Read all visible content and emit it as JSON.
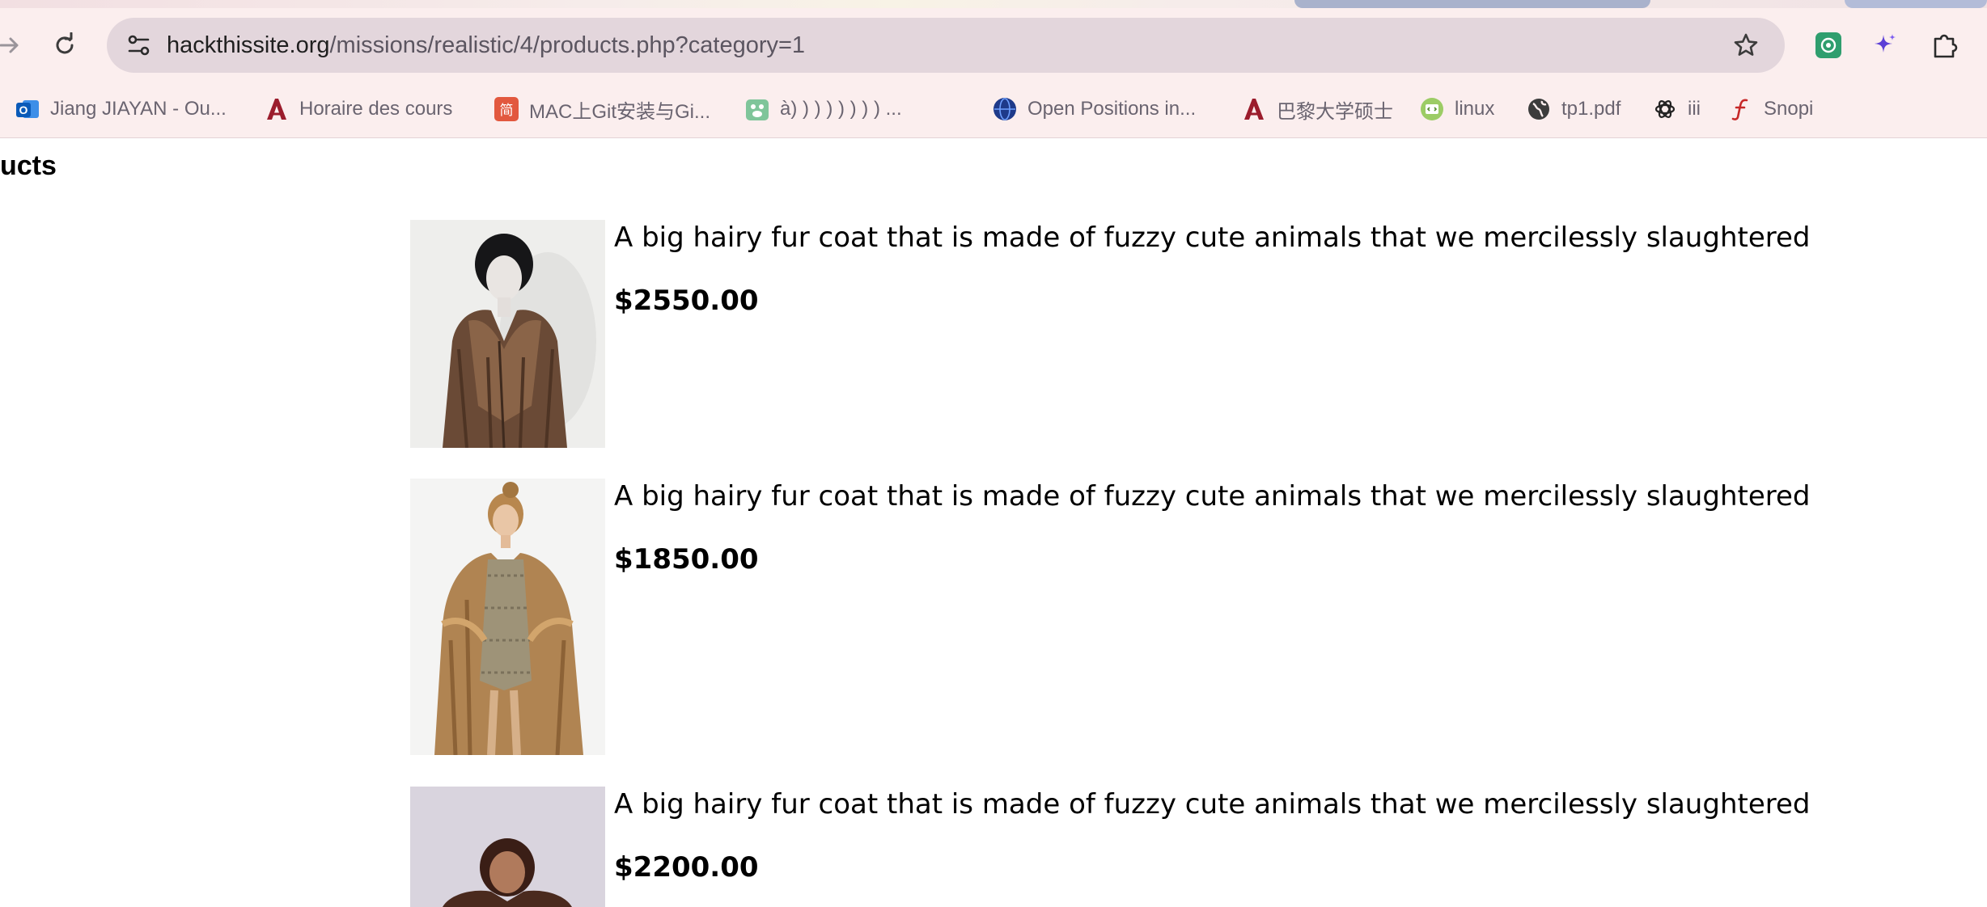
{
  "browser": {
    "url_host": "hackthissite.org",
    "url_path": "/missions/realistic/4/products.php?category=1",
    "bookmarks": [
      {
        "label": "Jiang JIAYAN - Ou...",
        "icon": "outlook-icon",
        "color": "#0a64c8"
      },
      {
        "label": "Horaire des cours",
        "icon": "university-logo-icon",
        "color": "#9b1c2c"
      },
      {
        "label": "MAC上Git安装与Gi...",
        "icon": "jianshu-icon",
        "color": "#e2583e"
      },
      {
        "label": "à) ) ) ) ) ) ) ) ...",
        "icon": "paw-icon",
        "color": "#5bb27c"
      },
      {
        "label": "Open Positions in...",
        "icon": "globe-badge-icon",
        "color": "#1e3a8a"
      },
      {
        "label": "巴黎大学硕士",
        "icon": "university-logo-icon",
        "color": "#9b1c2c"
      },
      {
        "label": "linux",
        "icon": "code-badge-icon",
        "color": "#8bc34a"
      },
      {
        "label": "tp1.pdf",
        "icon": "globe-icon",
        "color": "#3c3c3c"
      },
      {
        "label": "iii",
        "icon": "openai-icon",
        "color": "#222222"
      },
      {
        "label": "Snopi",
        "icon": "script-f-icon",
        "color": "#c62828"
      }
    ]
  },
  "page": {
    "title": "ucts"
  },
  "products": [
    {
      "description": "A big hairy fur coat that is made of fuzzy cute animals that we mercilessly slaughtered",
      "price": "$2550.00"
    },
    {
      "description": "A big hairy fur coat that is made of fuzzy cute animals that we mercilessly slaughtered",
      "price": "$1850.00"
    },
    {
      "description": "A big hairy fur coat that is made of fuzzy cute animals that we mercilessly slaughtered",
      "price": "$2200.00"
    }
  ]
}
